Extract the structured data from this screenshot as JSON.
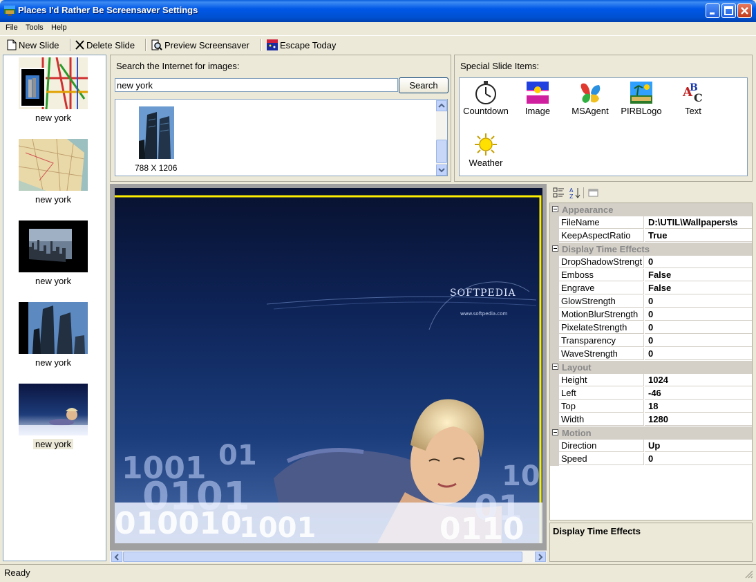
{
  "window": {
    "title": "Places I'd Rather Be Screensaver Settings"
  },
  "menu": {
    "items": [
      "File",
      "Tools",
      "Help"
    ]
  },
  "toolbar": {
    "new_slide": "New Slide",
    "delete_slide": "Delete Slide",
    "preview": "Preview Screensaver",
    "escape": "Escape Today"
  },
  "slides": [
    {
      "label": "new york"
    },
    {
      "label": "new york"
    },
    {
      "label": "new york"
    },
    {
      "label": "new york"
    },
    {
      "label": "new york",
      "selected": true
    }
  ],
  "search": {
    "heading": "Search the Internet for images:",
    "query": "new york",
    "button": "Search",
    "results": [
      {
        "caption": "788 X 1206"
      }
    ]
  },
  "special": {
    "heading": "Special Slide Items:",
    "items": [
      "Countdown",
      "Image",
      "MSAgent",
      "PIRBLogo",
      "Text",
      "Weather"
    ]
  },
  "preview": {
    "watermark": "SOFTPEDIA",
    "url": "www.softpedia.com"
  },
  "properties": {
    "categories": [
      {
        "name": "Appearance",
        "props": [
          {
            "name": "FileName",
            "value": "D:\\UTIL\\Wallpapers\\s"
          },
          {
            "name": "KeepAspectRatio",
            "value": "True"
          }
        ]
      },
      {
        "name": "Display Time Effects",
        "props": [
          {
            "name": "DropShadowStrengt",
            "value": "0"
          },
          {
            "name": "Emboss",
            "value": "False"
          },
          {
            "name": "Engrave",
            "value": "False"
          },
          {
            "name": "GlowStrength",
            "value": "0"
          },
          {
            "name": "MotionBlurStrength",
            "value": "0"
          },
          {
            "name": "PixelateStrength",
            "value": "0"
          },
          {
            "name": "Transparency",
            "value": "0"
          },
          {
            "name": "WaveStrength",
            "value": "0"
          }
        ]
      },
      {
        "name": "Layout",
        "props": [
          {
            "name": "Height",
            "value": "1024"
          },
          {
            "name": "Left",
            "value": "-46"
          },
          {
            "name": "Top",
            "value": "18"
          },
          {
            "name": "Width",
            "value": "1280"
          }
        ]
      },
      {
        "name": "Motion",
        "props": [
          {
            "name": "Direction",
            "value": "Up"
          },
          {
            "name": "Speed",
            "value": "0"
          }
        ]
      }
    ],
    "description": "Display Time Effects"
  },
  "status": {
    "text": "Ready"
  },
  "colors": {
    "title_bar": "#0058e6",
    "window_bg": "#ece9d8",
    "preview_bg": "#0c1a45",
    "preview_border": "#ffee00"
  }
}
